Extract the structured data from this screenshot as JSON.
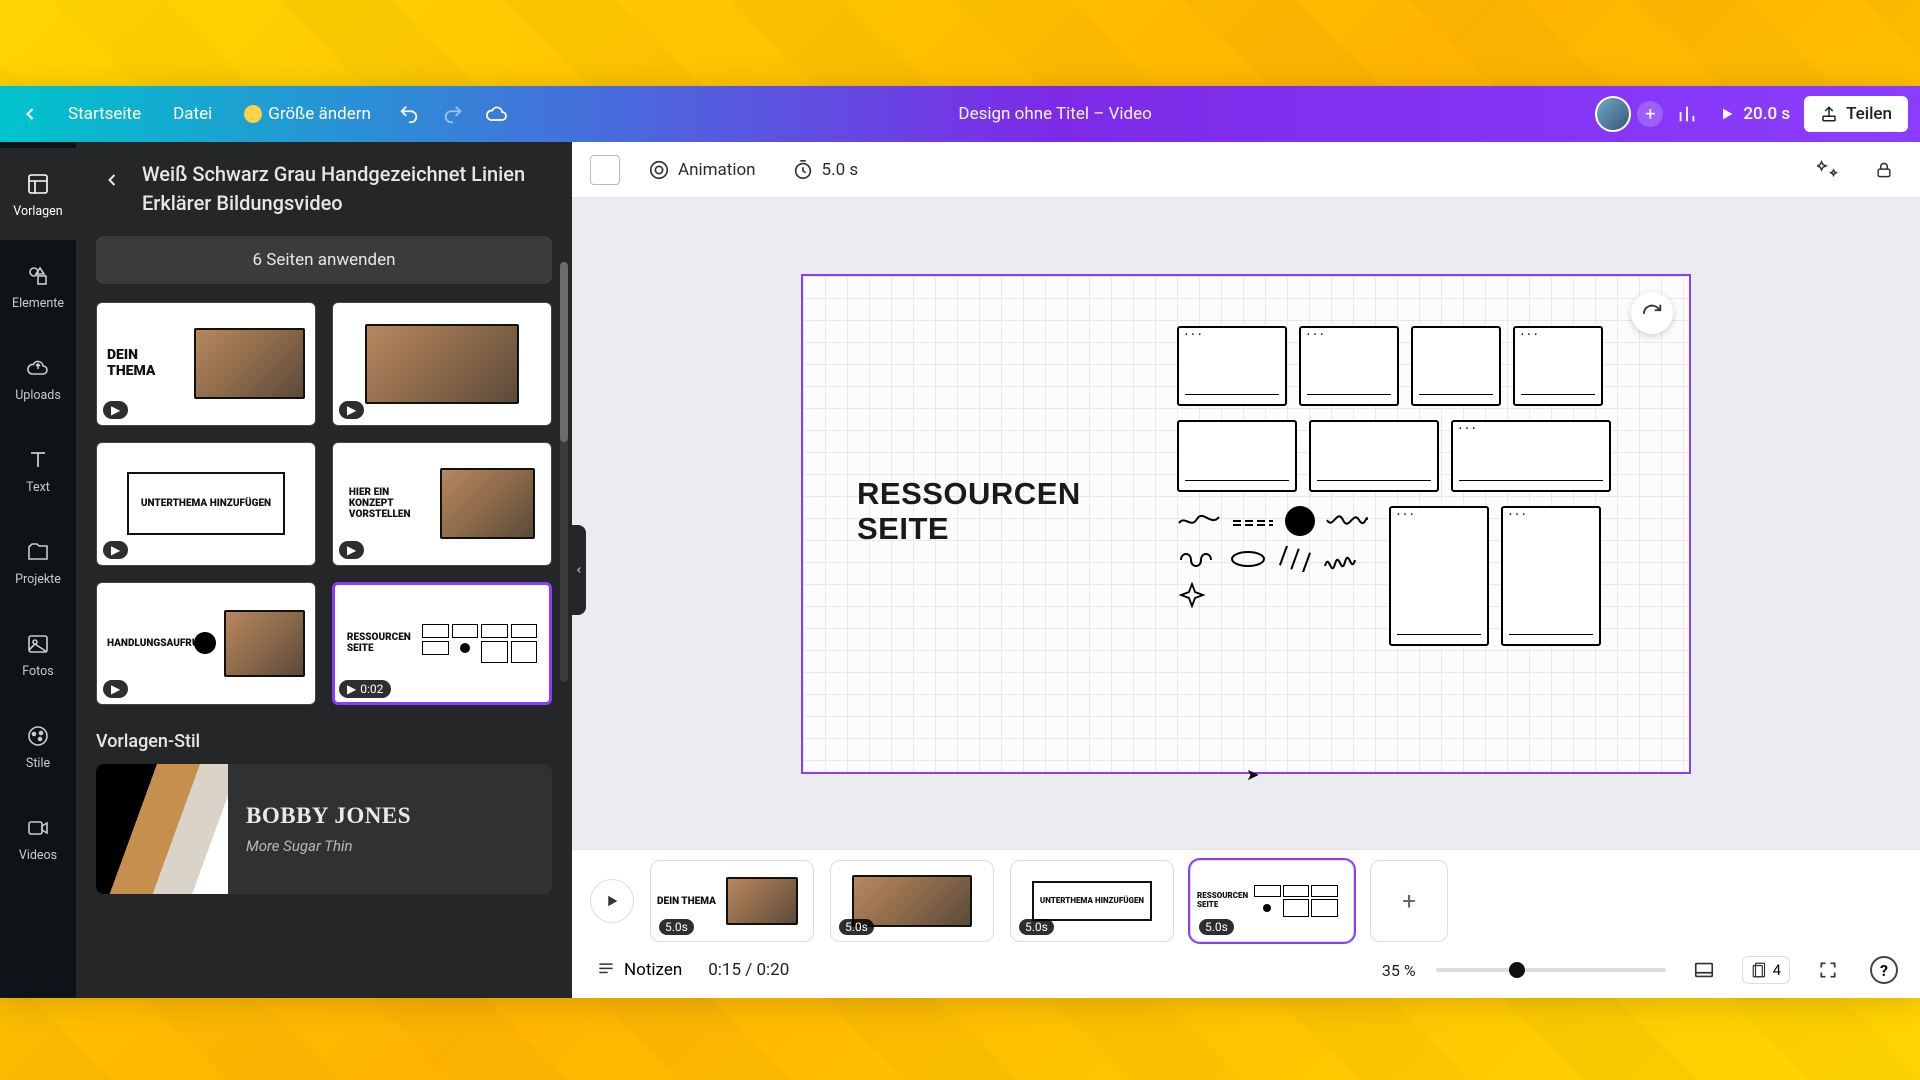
{
  "header": {
    "home": "Startseite",
    "file": "Datei",
    "resize": "Größe ändern",
    "doc_title": "Design ohne Titel – Video",
    "duration": "20.0 s",
    "share": "Teilen"
  },
  "rail": {
    "templates": "Vorlagen",
    "elements": "Elemente",
    "uploads": "Uploads",
    "text": "Text",
    "projects": "Projekte",
    "photos": "Fotos",
    "styles": "Stile",
    "videos": "Videos"
  },
  "panel": {
    "title": "Weiß Schwarz Grau Handgezeichnet Linien Erklärer Bildungsvideo",
    "apply_all": "6 Seiten anwenden",
    "section_style": "Vorlagen-Stil",
    "style_name": "BOBBY JONES",
    "style_sub": "More Sugar Thin",
    "thumbs": [
      {
        "title": "DEIN THEMA",
        "dur": ""
      },
      {
        "title": "",
        "dur": ""
      },
      {
        "title": "UNTERTHEMA HINZUFÜGEN",
        "dur": ""
      },
      {
        "title": "HIER EIN KONZEPT VORSTELLEN",
        "dur": ""
      },
      {
        "title": "HANDLUNGSAUFRUF",
        "dur": ""
      },
      {
        "title": "RESSOURCEN SEITE",
        "dur": "0:02"
      }
    ]
  },
  "context": {
    "animation": "Animation",
    "page_duration": "5.0 s"
  },
  "canvas": {
    "page_heading": "RESSOURCEN\nSEITE"
  },
  "timeline": {
    "clips": [
      {
        "label": "DEIN THEMA",
        "dur": "5.0s"
      },
      {
        "label": "",
        "dur": "5.0s"
      },
      {
        "label": "UNTERTHEMA HINZUFÜGEN",
        "dur": "5.0s"
      },
      {
        "label": "RESSOURCEN SEITE",
        "dur": "5.0s"
      }
    ]
  },
  "footer": {
    "notes": "Notizen",
    "time": "0:15 / 0:20",
    "zoom": "35 %",
    "zoom_pct": 35,
    "page_count": "4"
  }
}
